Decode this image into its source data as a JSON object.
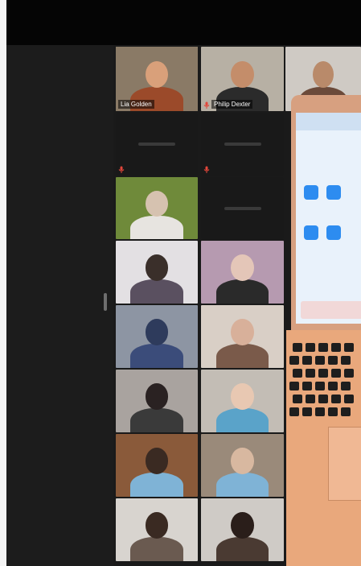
{
  "window": {
    "title": ""
  },
  "participants": [
    {
      "name": "Lia Golden",
      "speaking": true,
      "muted": false,
      "bg": "#8a7a66",
      "skin": "#d9a07a",
      "shirt": "#9b4a2a"
    },
    {
      "name": "Philip Dexter",
      "speaking": false,
      "muted": true,
      "bg": "#b7b0a4",
      "skin": "#c48d6a",
      "shirt": "#2b2b2b"
    },
    {
      "name": "",
      "speaking": false,
      "muted": false,
      "bg": "#cfcac4",
      "skin": "#b98a6a",
      "shirt": "#6b4a3a"
    },
    {
      "name": "",
      "speaking": false,
      "muted": true,
      "bg": "#191919",
      "empty": true
    },
    {
      "name": "",
      "speaking": false,
      "muted": true,
      "bg": "#191919",
      "empty": true
    },
    {
      "name": "",
      "speaking": false,
      "muted": false,
      "bg": "#6f8a3a",
      "skin": "#d6c2b0",
      "shirt": "#e7e4e0"
    },
    {
      "name": "",
      "speaking": false,
      "muted": false,
      "bg": "#191919",
      "empty": true
    },
    {
      "name": "",
      "speaking": false,
      "muted": false,
      "bg": "#e3e0e3",
      "skin": "#3a2f2a",
      "shirt": "#5a5060"
    },
    {
      "name": "",
      "speaking": false,
      "muted": false,
      "bg": "#b69ab0",
      "skin": "#e4c6b8",
      "shirt": "#2a2a2a"
    },
    {
      "name": "",
      "speaking": false,
      "muted": false,
      "bg": "#8d95a3",
      "skin": "#2e3b5c",
      "shirt": "#3b4c7a"
    },
    {
      "name": "",
      "speaking": false,
      "muted": false,
      "bg": "#d9cfc6",
      "skin": "#d8b09a",
      "shirt": "#7a5a4a"
    },
    {
      "name": "",
      "speaking": false,
      "muted": false,
      "bg": "#a9a39f",
      "skin": "#2a2222",
      "shirt": "#3a3a3a"
    },
    {
      "name": "",
      "speaking": false,
      "muted": false,
      "bg": "#c3bdb5",
      "skin": "#e8c8b2",
      "shirt": "#5aa3c9"
    },
    {
      "name": "",
      "speaking": false,
      "muted": false,
      "bg": "#8a5a3a",
      "skin": "#3a2a22",
      "shirt": "#7fb3d6"
    },
    {
      "name": "",
      "speaking": false,
      "muted": false,
      "bg": "#9a8a7a",
      "skin": "#d8b8a0",
      "shirt": "#7fb3d6"
    },
    {
      "name": "",
      "speaking": false,
      "muted": false,
      "bg": "#d8d4cf",
      "skin": "#3a2a22",
      "shirt": "#6a5a50"
    },
    {
      "name": "",
      "speaking": false,
      "muted": false,
      "bg": "#cfcbc6",
      "skin": "#2a1e1a",
      "shirt": "#4a3a32"
    }
  ],
  "colors": {
    "speaking_border": "#d9e59a",
    "mute_icon": "#e2463a",
    "panel": "#1c1c1c"
  }
}
